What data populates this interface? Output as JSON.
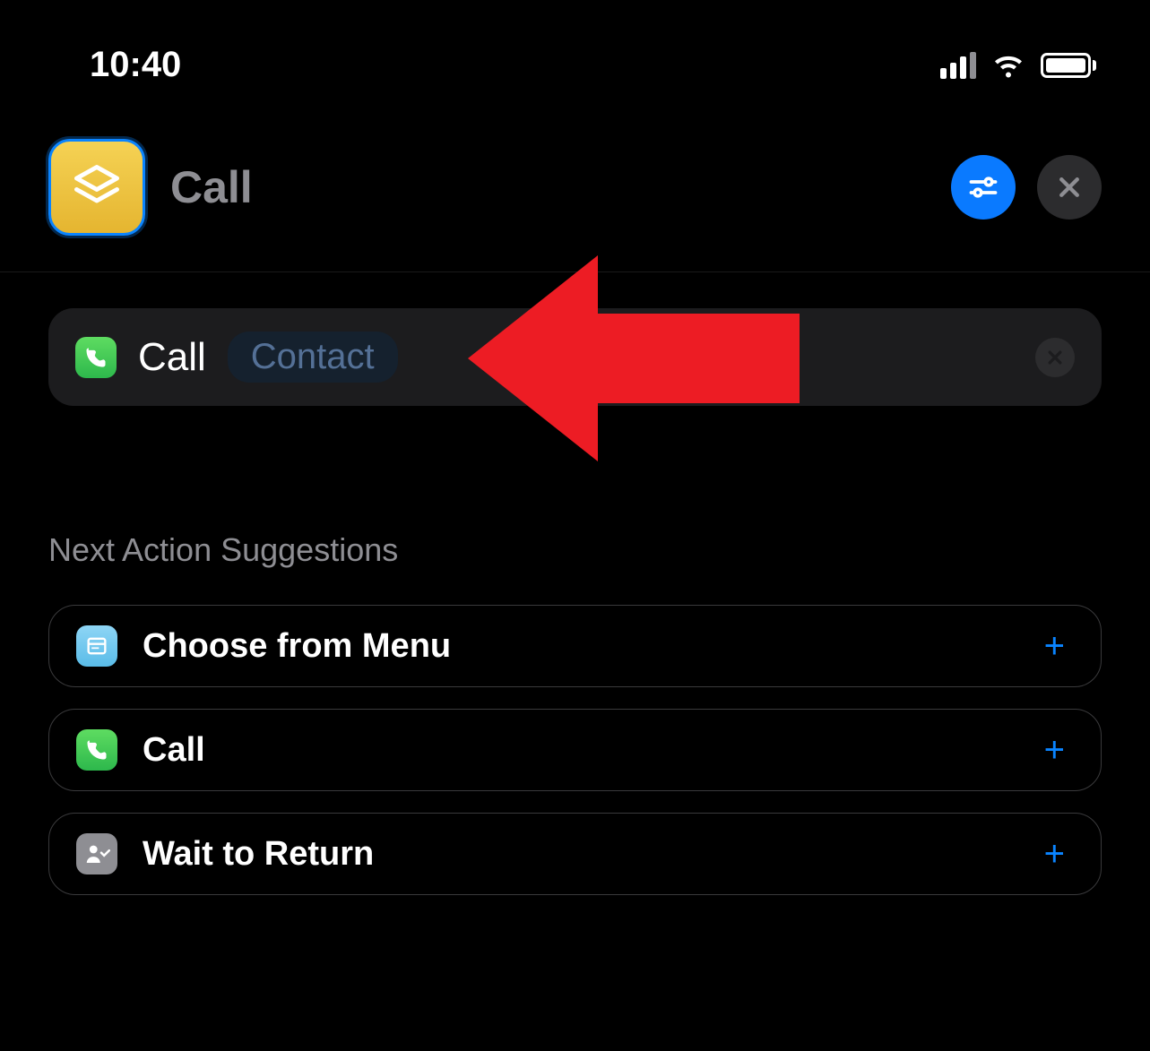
{
  "statusBar": {
    "time": "10:40"
  },
  "header": {
    "title": "Call"
  },
  "actionCard": {
    "label": "Call",
    "parameter": "Contact"
  },
  "suggestions": {
    "header": "Next Action Suggestions",
    "items": [
      {
        "label": "Choose from Menu"
      },
      {
        "label": "Call"
      },
      {
        "label": "Wait to Return"
      }
    ]
  }
}
